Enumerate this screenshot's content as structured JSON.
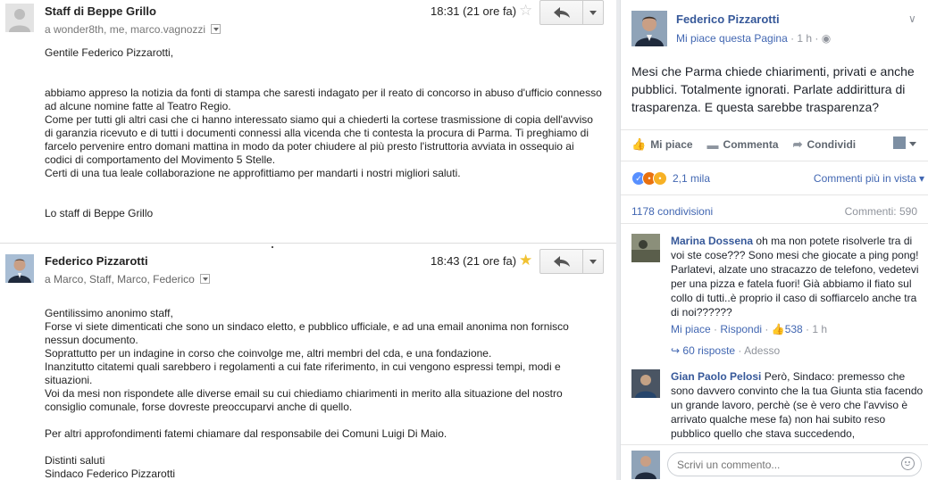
{
  "gmail": {
    "message1": {
      "sender": "Staff di Beppe Grillo",
      "recipients": "a wonder8th, me, marco.vagnozzi",
      "time": "18:31 (21 ore fa)",
      "starred": false,
      "greeting": "Gentile Federico Pizzarotti,",
      "paragraph": "abbiamo appreso la notizia da fonti di stampa che saresti indagato per il reato di concorso in abuso d'ufficio connesso ad alcune nomine fatte al Teatro Regio.\nCome per tutti gli altri casi che ci hanno interessato siamo qui a chiederti la cortese trasmissione di copia dell'avviso di garanzia ricevuto e di tutti i documenti connessi alla vicenda che ti contesta la procura di Parma. Ti preghiamo di farcelo pervenire entro domani mattina in modo da poter chiudere al più presto l'istruttoria avviata in ossequio ai codici di comportamento del Movimento 5 Stelle.\nCerti di una tua leale collaborazione ne approfittiamo per mandarti i nostri migliori saluti.",
      "signature": "Lo staff di Beppe Grillo"
    },
    "message2": {
      "sender": "Federico Pizzarotti",
      "recipients": "a Marco, Staff, Marco, Federico",
      "time": "18:43 (21 ore fa)",
      "starred": true,
      "paragraph1": "Gentilissimo anonimo staff,\nForse vi siete dimenticati che sono un sindaco eletto, e pubblico ufficiale, e ad una email anonima non fornisco nessun documento.\nSoprattutto per un indagine in corso che coinvolge me, altri membri del cda, e una fondazione.\nInanzitutto citatemi quali sarebbero i regolamenti a cui fate riferimento, in cui vengono espressi tempi, modi e situazioni.\nVoi da mesi non rispondete alle diverse email su cui chiediamo chiarimenti in merito alla situazione del nostro consiglio comunale, forse dovreste preoccuparvi anche di quello.",
      "paragraph2": "Per altri approfondimenti fatemi chiamare dal responsabile dei Comuni Luigi Di Maio.",
      "closing": "Distinti saluti\nSindaco Federico Pizzarotti"
    }
  },
  "facebook": {
    "author": "Federico Pizzarotti",
    "meta_like": "Mi piace questa Pagina",
    "meta_time": " · 1 h · ",
    "post_text": "Mesi che Parma chiede chiarimenti, privati e anche pubblici. Totalmente ignorati. Parlate addirittura di trasparenza. E questa sarebbe trasparenza?",
    "actions": {
      "like": "Mi piace",
      "comment": "Commenta",
      "share": "Condividi"
    },
    "reactions_count": "2,1 mila",
    "sort_label": "Commenti più in vista",
    "shares": "1178 condivisioni",
    "comments_count": "Commenti: 590",
    "comments": [
      {
        "name": "Marina Dossena",
        "text": "oh ma non potete risolverle tra di voi ste cose??? Sono mesi che giocate a ping pong! Parlatevi, alzate uno stracazzo de telefono, vedetevi per una pizza e fatela fuori! Già abbiamo il fiato sul collo di tutti..è proprio il caso di soffiarcelo anche tra di noi??????",
        "like": "Mi piace",
        "reply": "Rispondi",
        "likes": "538",
        "time": "1 h",
        "replies": "60 risposte",
        "replies_time": "Adesso"
      },
      {
        "name": "Gian Paolo Pelosi",
        "text": "Però, Sindaco: premesso che sono davvero convinto che la tua Giunta stia facendo un grande lavoro, perchè (se è vero che l'avviso è arrivato qualche mese fa) non hai subito reso pubblico quello che stava succedendo,"
      }
    ],
    "comment_placeholder": "Scrivi un commento..."
  }
}
